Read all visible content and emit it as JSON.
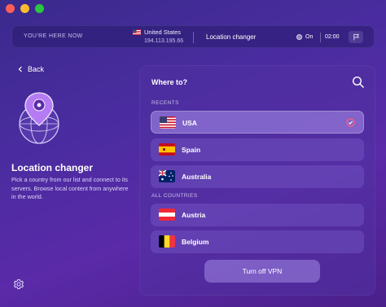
{
  "window": {
    "controls": [
      "close",
      "minimize",
      "maximize"
    ]
  },
  "status": {
    "here_label": "YOU'RE HERE NOW",
    "country": "United States",
    "ip": "194.113.195.66",
    "feature": "Location changer",
    "toggle_label": "On",
    "time": "02:00",
    "flag_icon": "flag-icon"
  },
  "nav": {
    "back_label": "Back"
  },
  "info": {
    "title": "Location changer",
    "description": "Pick a country from our list and connect to its servers. Browse local content from anywhere in the world."
  },
  "panel": {
    "title": "Where to?",
    "recents_label": "RECENTS",
    "all_label": "ALL COUNTRIES",
    "recents": [
      {
        "label": "USA",
        "flag": "us",
        "selected": true
      },
      {
        "label": "Spain",
        "flag": "es",
        "selected": false
      },
      {
        "label": "Australia",
        "flag": "au",
        "selected": false
      }
    ],
    "all": [
      {
        "label": "Austria",
        "flag": "at"
      },
      {
        "label": "Belgium",
        "flag": "be"
      }
    ],
    "cta_label": "Turn off VPN"
  },
  "colors": {
    "background": "#4a2ca0",
    "accent": "#ff5d7a",
    "row": "#8a6ad2",
    "row_selected": "#aa91eb"
  }
}
